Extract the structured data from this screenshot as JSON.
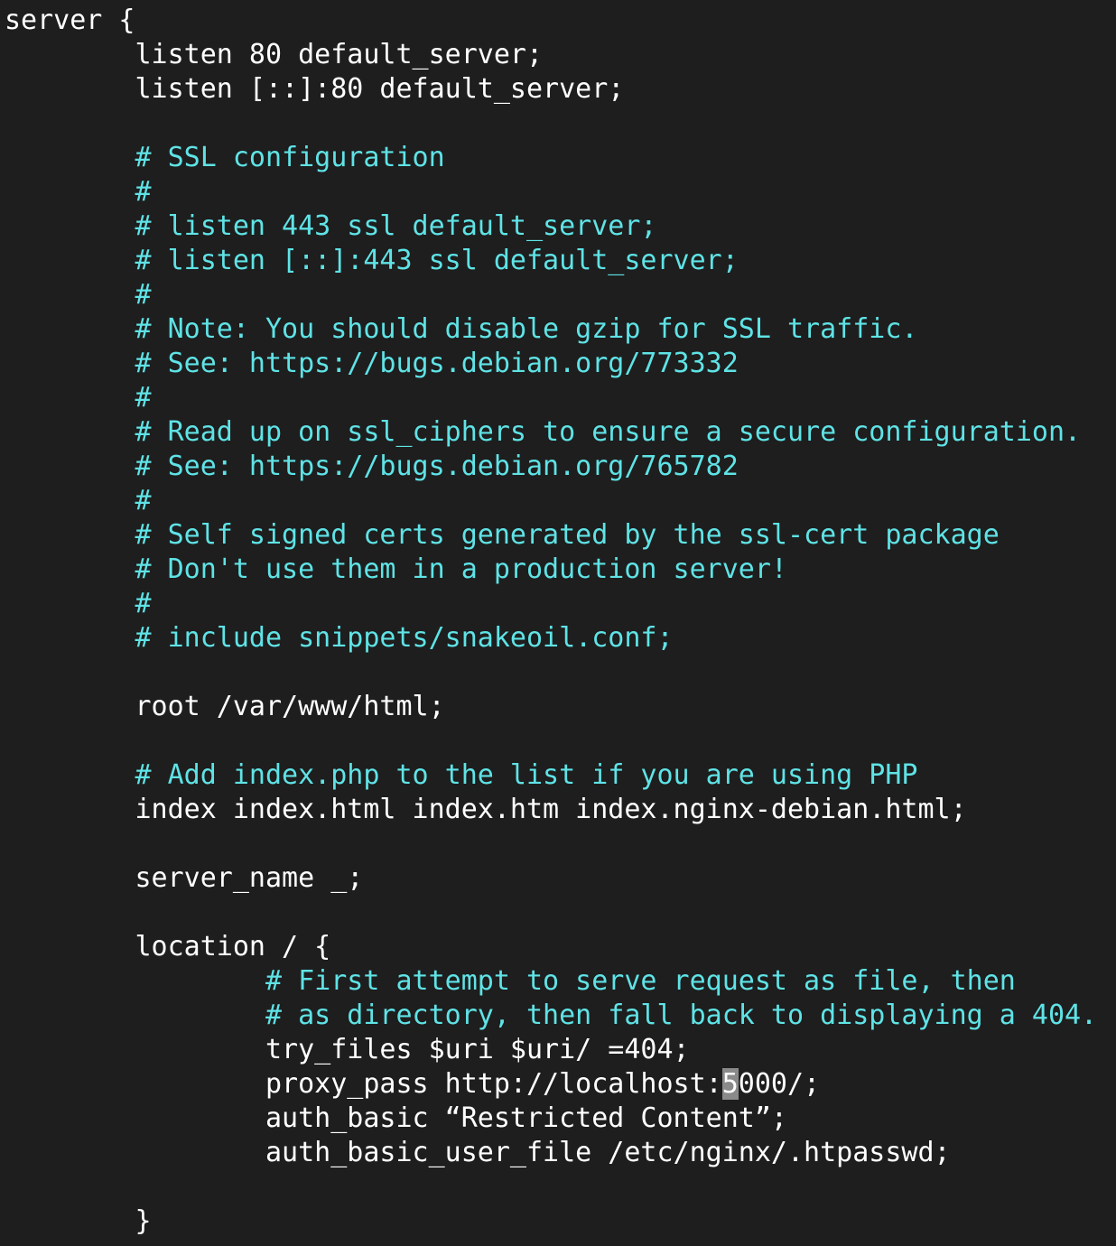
{
  "editor": {
    "cursor_char": "5",
    "lines": [
      {
        "indent": 0,
        "text": "server {",
        "kind": "code"
      },
      {
        "indent": 1,
        "text": "listen 80 default_server;",
        "kind": "code"
      },
      {
        "indent": 1,
        "text": "listen [::]:80 default_server;",
        "kind": "code"
      },
      {
        "indent": 0,
        "text": "",
        "kind": "blank"
      },
      {
        "indent": 1,
        "text": "# SSL configuration",
        "kind": "comment"
      },
      {
        "indent": 1,
        "text": "#",
        "kind": "comment"
      },
      {
        "indent": 1,
        "text": "# listen 443 ssl default_server;",
        "kind": "comment"
      },
      {
        "indent": 1,
        "text": "# listen [::]:443 ssl default_server;",
        "kind": "comment"
      },
      {
        "indent": 1,
        "text": "#",
        "kind": "comment"
      },
      {
        "indent": 1,
        "text": "# Note: You should disable gzip for SSL traffic.",
        "kind": "comment"
      },
      {
        "indent": 1,
        "text": "# See: https://bugs.debian.org/773332",
        "kind": "comment"
      },
      {
        "indent": 1,
        "text": "#",
        "kind": "comment"
      },
      {
        "indent": 1,
        "text": "# Read up on ssl_ciphers to ensure a secure configuration.",
        "kind": "comment"
      },
      {
        "indent": 1,
        "text": "# See: https://bugs.debian.org/765782",
        "kind": "comment"
      },
      {
        "indent": 1,
        "text": "#",
        "kind": "comment"
      },
      {
        "indent": 1,
        "text": "# Self signed certs generated by the ssl-cert package",
        "kind": "comment"
      },
      {
        "indent": 1,
        "text": "# Don't use them in a production server!",
        "kind": "comment"
      },
      {
        "indent": 1,
        "text": "#",
        "kind": "comment"
      },
      {
        "indent": 1,
        "text": "# include snippets/snakeoil.conf;",
        "kind": "comment"
      },
      {
        "indent": 0,
        "text": "",
        "kind": "blank"
      },
      {
        "indent": 1,
        "text": "root /var/www/html;",
        "kind": "code"
      },
      {
        "indent": 0,
        "text": "",
        "kind": "blank"
      },
      {
        "indent": 1,
        "text": "# Add index.php to the list if you are using PHP",
        "kind": "comment"
      },
      {
        "indent": 1,
        "text": "index index.html index.htm index.nginx-debian.html;",
        "kind": "code"
      },
      {
        "indent": 0,
        "text": "",
        "kind": "blank"
      },
      {
        "indent": 1,
        "text": "server_name _;",
        "kind": "code"
      },
      {
        "indent": 0,
        "text": "",
        "kind": "blank"
      },
      {
        "indent": 1,
        "text": "location / {",
        "kind": "code"
      },
      {
        "indent": 2,
        "text": "# First attempt to serve request as file, then",
        "kind": "comment"
      },
      {
        "indent": 2,
        "text": "# as directory, then fall back to displaying a 404.",
        "kind": "comment"
      },
      {
        "indent": 2,
        "text": "try_files $uri $uri/ =404;",
        "kind": "code"
      },
      {
        "indent": 2,
        "text": "proxy_pass http://localhost:",
        "after_cursor": "000/;",
        "kind": "cursor-line"
      },
      {
        "indent": 2,
        "text": "auth_basic “Restricted Content”;",
        "kind": "code"
      },
      {
        "indent": 2,
        "text": "auth_basic_user_file /etc/nginx/.htpasswd;",
        "kind": "code"
      },
      {
        "indent": 0,
        "text": "",
        "kind": "blank"
      },
      {
        "indent": 1,
        "text": "}",
        "kind": "code"
      }
    ]
  }
}
